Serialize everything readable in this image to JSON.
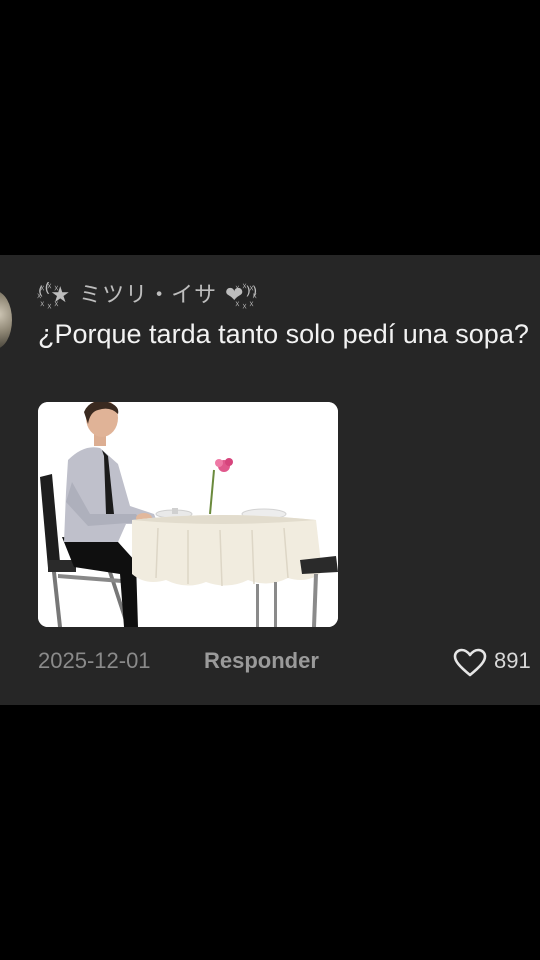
{
  "comment": {
    "username": "⁽⁽꙰★ ミツリ・イサ ❤︎꙰⁾⁾",
    "text": "¿Porque tarda tanto solo pedí una sopa?",
    "date": "2025-12-01",
    "reply_label": "Responder",
    "likes": "891"
  },
  "icons": {
    "avatar": "avatar-image",
    "like": "heart-outline-icon"
  },
  "colors": {
    "background": "#000000",
    "card": "#262626",
    "text_primary": "#f2f2f2",
    "text_secondary": "#8a8a8a"
  }
}
